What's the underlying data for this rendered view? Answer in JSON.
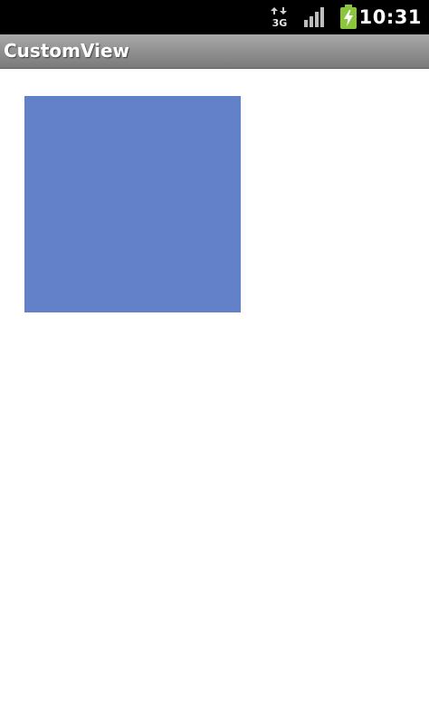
{
  "status_bar": {
    "network_type": "3G",
    "network_icon": "3g-data-icon",
    "signal_icon": "signal-strength-icon",
    "battery_icon": "battery-charging-icon",
    "time": "10:31"
  },
  "title_bar": {
    "title": "CustomView"
  },
  "content": {
    "custom_view": {
      "shape": "square",
      "color": "#6381C8"
    }
  },
  "colors": {
    "status_bar_bg": "#000000",
    "title_bar_bg": "#8E8E8E",
    "content_bg": "#FFFFFF",
    "battery_accent": "#8CC63F"
  }
}
